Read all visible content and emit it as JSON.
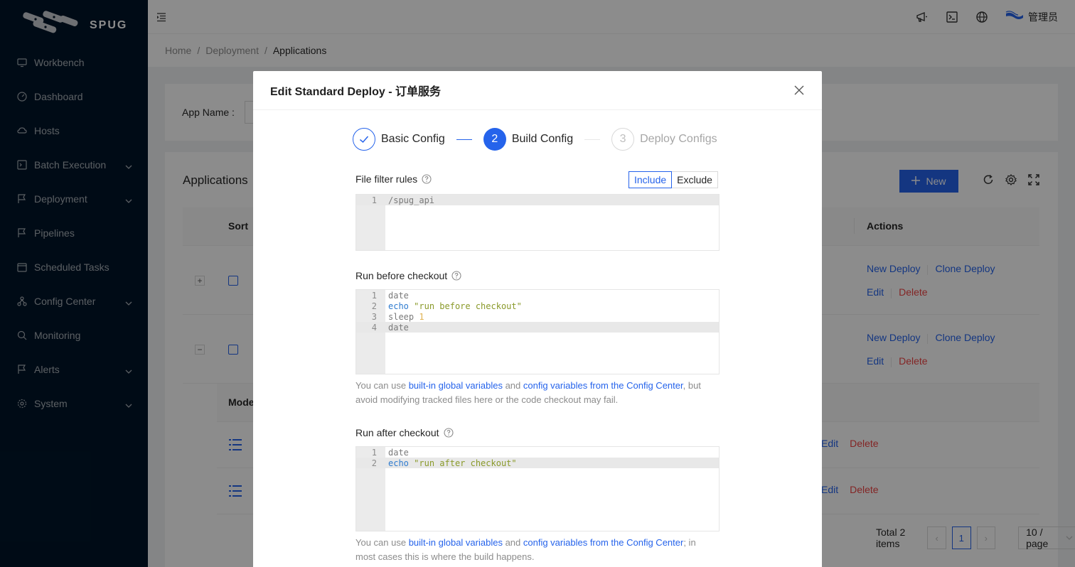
{
  "app": {
    "logo_text": "SPUG"
  },
  "sidebar": {
    "items": [
      {
        "label": "Workbench",
        "icon": "desktop-icon",
        "has_arrow": false
      },
      {
        "label": "Dashboard",
        "icon": "dashboard-icon",
        "has_arrow": false
      },
      {
        "label": "Hosts",
        "icon": "cloud-server-icon",
        "has_arrow": false
      },
      {
        "label": "Batch Execution",
        "icon": "code-icon",
        "has_arrow": true
      },
      {
        "label": "Deployment",
        "icon": "flag-icon",
        "has_arrow": true
      },
      {
        "label": "Pipelines",
        "icon": "pipeline-flag-icon",
        "has_arrow": false
      },
      {
        "label": "Scheduled Tasks",
        "icon": "schedule-icon",
        "has_arrow": false
      },
      {
        "label": "Config Center",
        "icon": "deployment-unit-icon",
        "has_arrow": true
      },
      {
        "label": "Monitoring",
        "icon": "monitor-icon",
        "has_arrow": false
      },
      {
        "label": "Alerts",
        "icon": "alert-icon",
        "has_arrow": true
      },
      {
        "label": "System",
        "icon": "setting-icon",
        "has_arrow": true
      }
    ]
  },
  "header": {
    "username": "管理员"
  },
  "breadcrumb": {
    "items": [
      "Home",
      "Deployment",
      "Applications"
    ]
  },
  "search": {
    "app_name_label": "App Name :"
  },
  "table": {
    "title": "Applications",
    "new_label": "New",
    "col_sort": "Sort",
    "col_actions": "Actions",
    "rows": [
      {
        "expand": "+",
        "new_deploy": "New Deploy",
        "clone_deploy": "Clone Deploy",
        "edit": "Edit",
        "delete": "Delete"
      },
      {
        "expand": "−",
        "new_deploy": "New Deploy",
        "clone_deploy": "Clone Deploy",
        "edit": "Edit",
        "delete": "Delete"
      }
    ],
    "sub_col": "Mode",
    "sub_rows": [
      {
        "edit": "Edit",
        "delete": "Delete"
      },
      {
        "edit": "Edit",
        "delete": "Delete"
      }
    ],
    "pagination": {
      "total": "Total 2 items",
      "current_page": "1",
      "page_size": "10 / page"
    }
  },
  "modal": {
    "title": "Edit Standard Deploy - 订单服务",
    "steps": [
      {
        "label": "Basic Config",
        "status": "done",
        "num": "1"
      },
      {
        "label": "Build Config",
        "status": "active",
        "num": "2"
      },
      {
        "label": "Deploy Configs",
        "status": "wait",
        "num": "3"
      }
    ],
    "filter": {
      "label": "File filter rules",
      "include": "Include",
      "exclude": "Exclude",
      "code": [
        {
          "n": "1",
          "t": "/spug_api"
        }
      ]
    },
    "before": {
      "label": "Run before checkout",
      "hint_pre": "You can use ",
      "link1": "built-in global variables",
      "hint_mid": " and ",
      "link2": "config variables from the Config Center",
      "hint_post": ", but avoid modifying tracked files here or the code checkout may fail."
    },
    "after": {
      "label": "Run after checkout",
      "hint_pre": "You can use ",
      "link1": "built-in global variables",
      "hint_mid": " and ",
      "link2": "config variables from the Config Center",
      "hint_post": "; in most cases this is where the build happens."
    }
  },
  "colors": {
    "primary": "#2563eb",
    "danger": "#ef4444",
    "sidebar_bg": "#001529"
  }
}
